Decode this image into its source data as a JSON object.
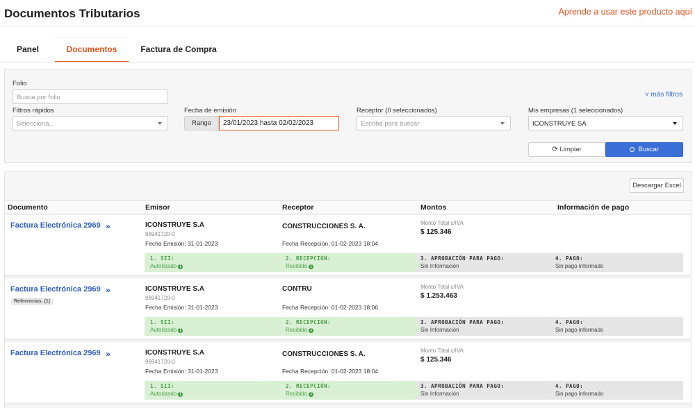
{
  "header": {
    "title": "Documentos Tributarios",
    "help_link": "Aprende a usar este producto aquí"
  },
  "tabs": [
    {
      "label": "Panel",
      "active": false
    },
    {
      "label": "Documentos",
      "active": true
    },
    {
      "label": "Factura de Compra",
      "active": false
    }
  ],
  "filters": {
    "folio_label": "Folio",
    "folio_placeholder": "Busca por folio",
    "more_filters": "˅ más filtros",
    "quick_label": "Filtros rápidos",
    "quick_placeholder": "Selecciona...",
    "date_label": "Fecha de emisión",
    "date_mode": "Rango",
    "date_value": "23/01/2023 hasta 02/02/2023",
    "receptor_label": "Receptor (0 seleccionados)",
    "receptor_placeholder": "Escriba para buscar",
    "empresas_label": "Mis empresas (1 seleccionados)",
    "empresas_value": "ICONSTRUYE SA",
    "clear_button": "Limpiar",
    "search_button": "Buscar"
  },
  "results": {
    "excel_button": "Descargar Excel",
    "columns": [
      "Documento",
      "Emisor",
      "Receptor",
      "Montos",
      "Información de pago"
    ],
    "rows": [
      {
        "doc": "Factura Electrónica 2969",
        "reference": "",
        "emisor": "ICONSTRUYE S.A",
        "rut": "96941720-0",
        "fecha_emision": "Fecha Emisión: 31-01-2023",
        "receptor": "CONSTRUCCIONES S. A.",
        "fecha_recepcion": "Fecha Recepción: 01-02-2023 18:04",
        "monto_label": "Monto Total c/IVA",
        "monto": "$ 125.346",
        "steps": [
          {
            "title": "1. SII:",
            "status": "Autorizado",
            "state": "ok"
          },
          {
            "title": "2. RECEPCIÓN:",
            "status": "Recibido",
            "state": "ok"
          },
          {
            "title": "3. APROBACIÓN PARA PAGO:",
            "status": "Sin Información",
            "state": "pending"
          },
          {
            "title": "4. PAGO:",
            "status": "Sin pago informado",
            "state": "pending"
          }
        ]
      },
      {
        "doc": "Factura Electrónica 2969",
        "reference": "Referencias. (1)",
        "emisor": "ICONSTRUYE S.A",
        "rut": "96941720-0",
        "fecha_emision": "Fecha Emisión: 31-01-2023",
        "receptor": "CONTRU",
        "fecha_recepcion": "Fecha Recepción: 01-02-2023 18:06",
        "monto_label": "Monto Total c/IVA",
        "monto": "$ 1.253.463",
        "steps": [
          {
            "title": "1. SII:",
            "status": "Autorizado",
            "state": "ok"
          },
          {
            "title": "2. RECEPCIÓN:",
            "status": "Recibido",
            "state": "ok"
          },
          {
            "title": "3. APROBACIÓN PARA PAGO:",
            "status": "Sin Información",
            "state": "pending"
          },
          {
            "title": "4. PAGO:",
            "status": "Sin pago informado",
            "state": "pending"
          }
        ]
      },
      {
        "doc": "Factura Electrónica 2969",
        "reference": "",
        "emisor": "ICONSTRUYE S.A",
        "rut": "96941720-0",
        "fecha_emision": "Fecha Emisión: 31-01-2023",
        "receptor": "CONSTRUCCIONES S. A.",
        "fecha_recepcion": "Fecha Recepción: 01-02-2023 18:04",
        "monto_label": "Monto Total c/IVA",
        "monto": "$ 125.346",
        "steps": [
          {
            "title": "1. SII:",
            "status": "Autorizado",
            "state": "ok"
          },
          {
            "title": "2. RECEPCIÓN:",
            "status": "Recibido",
            "state": "ok"
          },
          {
            "title": "3. APROBACIÓN PARA PAGO:",
            "status": "Sin Información",
            "state": "pending"
          },
          {
            "title": "4. PAGO:",
            "status": "Sin pago informado",
            "state": "pending"
          }
        ]
      }
    ]
  },
  "colors": {
    "accent": "#e8541e",
    "primary": "#3b6fd8",
    "link": "#2f5fb8",
    "success_bg": "#d9f0d5",
    "success_text": "#4a9e44",
    "pending_bg": "#e6e6e6"
  }
}
